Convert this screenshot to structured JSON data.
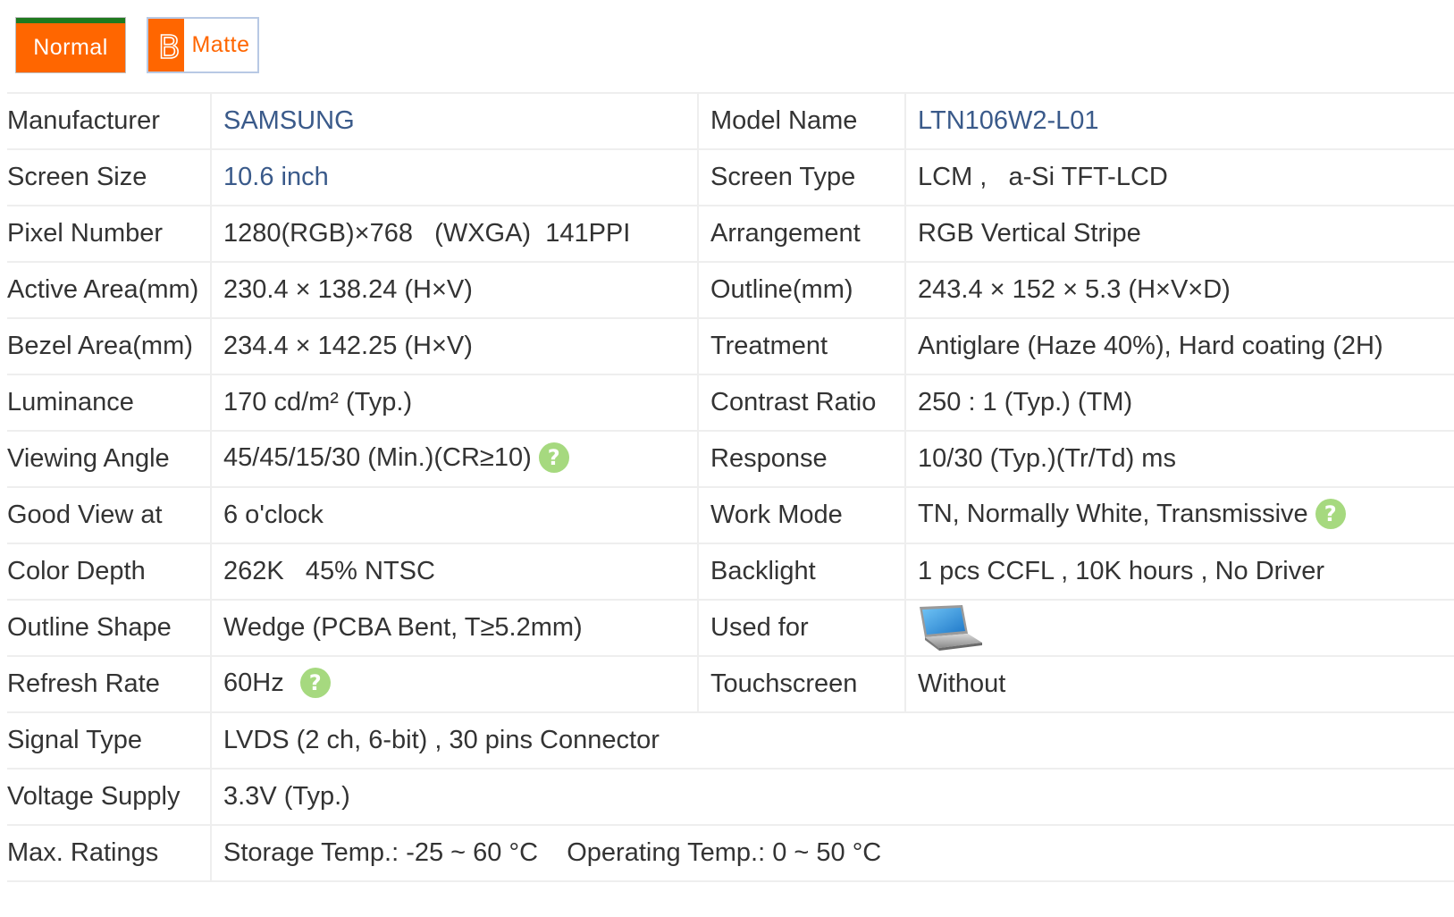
{
  "badges": {
    "normal_label": "Normal",
    "matte_letter": "B",
    "matte_label": "Matte"
  },
  "colors": {
    "accent_orange": "#ff6600",
    "strip_green": "#1f7a1f",
    "link_blue": "#3a5a8a",
    "help_green": "#a6d97f"
  },
  "help_icon_glyph": "?",
  "specs": {
    "manufacturer_label": "Manufacturer",
    "manufacturer_value": "SAMSUNG",
    "model_name_label": "Model Name",
    "model_name_value": "LTN106W2-L01",
    "screen_size_label": "Screen Size",
    "screen_size_value": "10.6 inch",
    "screen_type_label": "Screen Type",
    "screen_type_value": "LCM ,   a-Si TFT-LCD",
    "pixel_number_label": "Pixel Number",
    "pixel_number_value": "1280(RGB)×768   (WXGA)  141PPI",
    "arrangement_label": "Arrangement",
    "arrangement_value": "RGB Vertical Stripe",
    "active_area_label": "Active Area(mm)",
    "active_area_value": "230.4 × 138.24 (H×V)",
    "outline_label": "Outline(mm)",
    "outline_value": "243.4 × 152 × 5.3 (H×V×D)",
    "bezel_area_label": "Bezel Area(mm)",
    "bezel_area_value": "234.4 × 142.25 (H×V)",
    "treatment_label": "Treatment",
    "treatment_value": "Antiglare (Haze 40%), Hard coating (2H)",
    "luminance_label": "Luminance",
    "luminance_value": "170 cd/m² (Typ.)",
    "contrast_ratio_label": "Contrast Ratio",
    "contrast_ratio_value": "250 : 1 (Typ.) (TM)",
    "viewing_angle_label": "Viewing Angle",
    "viewing_angle_value": "45/45/15/30 (Min.)(CR≥10)",
    "response_label": "Response",
    "response_value": "10/30 (Typ.)(Tr/Td) ms",
    "good_view_label": "Good View at",
    "good_view_value": "6 o'clock",
    "work_mode_label": "Work Mode",
    "work_mode_value": "TN, Normally White, Transmissive",
    "color_depth_label": "Color Depth",
    "color_depth_value": "262K   45% NTSC",
    "backlight_label": "Backlight",
    "backlight_value": "1 pcs CCFL , 10K hours , No Driver",
    "outline_shape_label": "Outline Shape",
    "outline_shape_value": "Wedge (PCBA Bent, T≥5.2mm)",
    "used_for_label": "Used for",
    "used_for_icon": "laptop-icon",
    "refresh_rate_label": "Refresh Rate",
    "refresh_rate_value": "60Hz",
    "touchscreen_label": "Touchscreen",
    "touchscreen_value": "Without",
    "signal_type_label": "Signal Type",
    "signal_type_value": "LVDS (2 ch, 6-bit) , 30 pins Connector",
    "voltage_supply_label": "Voltage Supply",
    "voltage_supply_value": "3.3V (Typ.)",
    "max_ratings_label": "Max. Ratings",
    "max_ratings_value": "Storage Temp.: -25 ~ 60 °C    Operating Temp.: 0 ~ 50 °C"
  }
}
